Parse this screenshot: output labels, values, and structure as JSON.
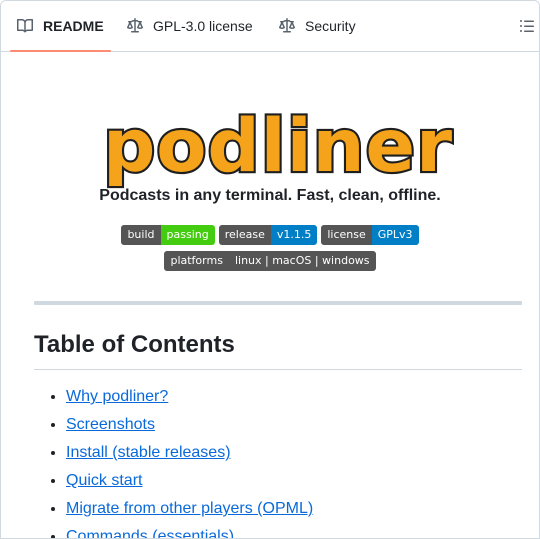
{
  "tabs": {
    "readme": "README",
    "license": "GPL-3.0 license",
    "security": "Security"
  },
  "readme": {
    "logo_text": "podliner",
    "tagline": "Podcasts in any terminal. Fast, clean, offline.",
    "badges": [
      {
        "label": "build",
        "value": "passing",
        "color": "#4c1"
      },
      {
        "label": "release",
        "value": "v1.1.5",
        "color": "#007ec6"
      },
      {
        "label": "license",
        "value": "GPLv3",
        "color": "#007ec6"
      },
      {
        "label": "platforms",
        "value": "linux | macOS | windows",
        "color": "#555555"
      }
    ],
    "toc_title": "Table of Contents",
    "toc_items": [
      "Why podliner?",
      "Screenshots",
      "Install (stable releases)",
      "Quick start",
      "Migrate from other players (OPML)",
      "Commands (essentials)"
    ]
  },
  "icons": {
    "readme": "book-icon",
    "license": "law-icon",
    "security": "law-icon",
    "outline": "list-unordered-icon"
  },
  "colors": {
    "logo_fill": "#f5a31a",
    "logo_stroke": "#1f1f1f",
    "link": "#0969da",
    "active_tab_underline": "#fd8c73"
  }
}
